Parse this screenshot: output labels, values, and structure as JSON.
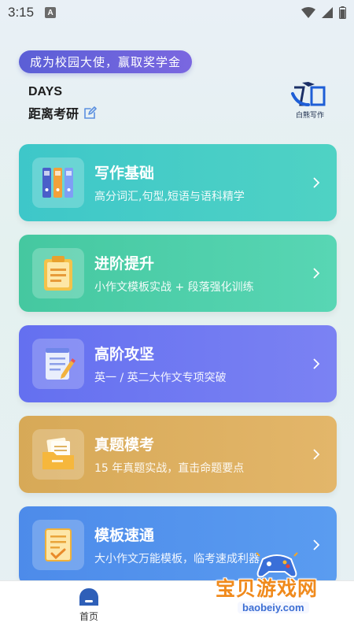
{
  "status_bar": {
    "time": "3:15",
    "notification_badge": "A",
    "icons": [
      "wifi-icon",
      "signal-icon",
      "battery-icon"
    ]
  },
  "promo": {
    "label": "成为校园大使，赢取奖学金"
  },
  "countdown": {
    "days_label": "DAYS",
    "title": "距离考研"
  },
  "logo": {
    "text": "白熊写作",
    "icon": "owl-logo"
  },
  "cards": [
    {
      "title": "写作基础",
      "subtitle": "高分词汇,句型,短语与语科精学",
      "icon": "binders-icon",
      "color": "#3ec7c9"
    },
    {
      "title": "进阶提升",
      "subtitle": "小作文模板实战 + 段落强化训练",
      "icon": "clipboard-icon",
      "color": "#45c8a0"
    },
    {
      "title": "高阶攻坚",
      "subtitle": "英一 / 英二大作文专项突破",
      "icon": "notepad-pen-icon",
      "color": "#6470f0"
    },
    {
      "title": "真题模考",
      "subtitle": "15 年真题实战，直击命题要点",
      "icon": "folder-docs-icon",
      "color": "#d7a957"
    },
    {
      "title": "模板速通",
      "subtitle": "大小作文万能模板，临考速成利器",
      "icon": "checked-doc-icon",
      "color": "#4d8bea"
    }
  ],
  "bottom_nav": {
    "home_label": "首页"
  },
  "watermark": {
    "main": "宝贝游戏网",
    "url": "baobeiy.com"
  }
}
